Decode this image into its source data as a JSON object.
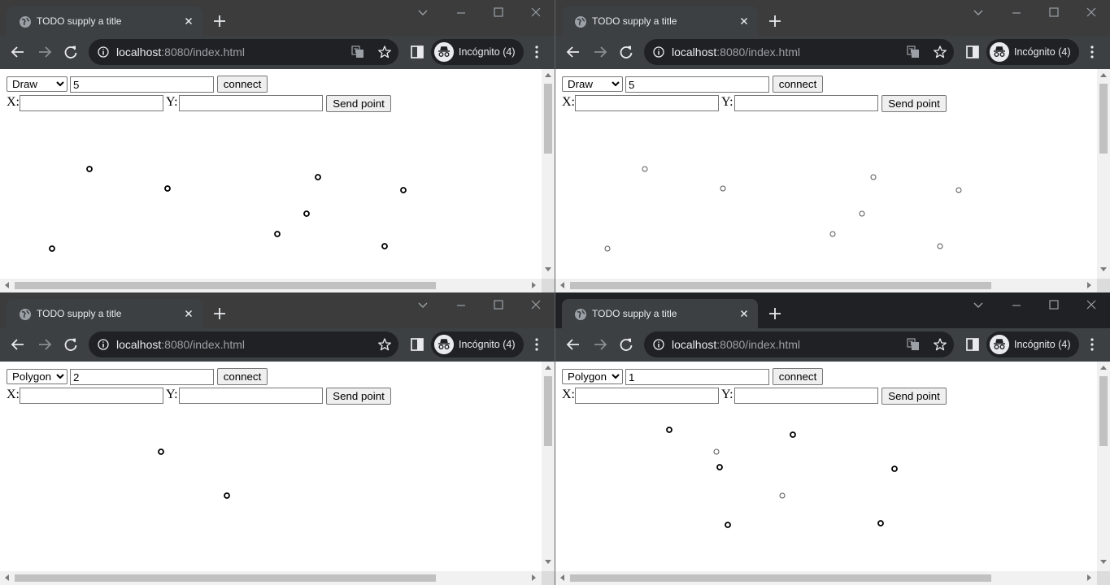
{
  "windows": [
    {
      "tab_title": "TODO supply a title",
      "url_host": "localhost",
      "url_rest": ":8080/index.html",
      "profile_label": "Incógnito (4)",
      "mode_options": [
        "Draw",
        "Polygon"
      ],
      "mode_value": "Draw",
      "id_value": "5",
      "connect_label": "connect",
      "x_label": "X:",
      "y_label": "Y:",
      "x_value": "",
      "y_value": "",
      "send_label": "Send point",
      "active": false,
      "translate_icon": true,
      "points": [
        [
          110,
          123,
          "heavy"
        ],
        [
          206,
          147,
          "heavy"
        ],
        [
          391,
          133,
          "heavy"
        ],
        [
          496,
          149,
          "heavy"
        ],
        [
          377,
          178,
          "heavy"
        ],
        [
          341,
          203,
          "heavy"
        ],
        [
          473,
          218,
          "heavy"
        ],
        [
          64,
          221,
          "heavy"
        ]
      ]
    },
    {
      "tab_title": "TODO supply a title",
      "url_host": "localhost",
      "url_rest": ":8080/index.html",
      "profile_label": "Incógnito (4)",
      "mode_options": [
        "Draw",
        "Polygon"
      ],
      "mode_value": "Draw",
      "id_value": "5",
      "connect_label": "connect",
      "x_label": "X:",
      "y_label": "Y:",
      "x_value": "",
      "y_value": "",
      "send_label": "Send point",
      "active": false,
      "translate_icon": true,
      "points": [
        [
          110,
          123,
          "light"
        ],
        [
          206,
          147,
          "light"
        ],
        [
          391,
          133,
          "light"
        ],
        [
          496,
          149,
          "light"
        ],
        [
          377,
          178,
          "light"
        ],
        [
          341,
          203,
          "light"
        ],
        [
          473,
          218,
          "light"
        ],
        [
          64,
          221,
          "light"
        ]
      ]
    },
    {
      "tab_title": "TODO supply a title",
      "url_host": "localhost",
      "url_rest": ":8080/index.html",
      "profile_label": "Incógnito (4)",
      "mode_options": [
        "Draw",
        "Polygon"
      ],
      "mode_value": "Polygon",
      "id_value": "2",
      "connect_label": "connect",
      "x_label": "X:",
      "y_label": "Y:",
      "x_value": "",
      "y_value": "",
      "send_label": "Send point",
      "active": false,
      "translate_icon": false,
      "points": [
        [
          198,
          111,
          "heavy"
        ],
        [
          279,
          165,
          "heavy"
        ]
      ]
    },
    {
      "tab_title": "TODO supply a title",
      "url_host": "localhost",
      "url_rest": ":8080/index.html",
      "profile_label": "Incógnito (4)",
      "mode_options": [
        "Draw",
        "Polygon"
      ],
      "mode_value": "Polygon",
      "id_value": "1",
      "connect_label": "connect",
      "x_label": "X:",
      "y_label": "Y:",
      "x_value": "",
      "y_value": "",
      "send_label": "Send point",
      "active": true,
      "translate_icon": true,
      "points": [
        [
          140,
          84,
          "heavy"
        ],
        [
          292,
          90,
          "heavy"
        ],
        [
          198,
          111,
          "light"
        ],
        [
          202,
          130,
          "heavy"
        ],
        [
          417,
          132,
          "heavy"
        ],
        [
          279,
          165,
          "light"
        ],
        [
          212,
          201,
          "heavy"
        ],
        [
          400,
          199,
          "heavy"
        ]
      ]
    }
  ],
  "colors": {
    "titlebar_inactive": "#3c3c3c",
    "titlebar_active": "#202124",
    "toolbar": "#3c4043",
    "omnibox": "#202124",
    "text_light": "#e8eaed",
    "text_dim": "#9aa0a6"
  },
  "icons": [
    "globe-icon",
    "close-icon",
    "plus-icon",
    "minimize-icon",
    "maximize-icon",
    "chevron-down-icon",
    "back-arrow-icon",
    "forward-arrow-icon",
    "reload-icon",
    "info-icon",
    "translate-icon",
    "star-icon",
    "sidepanel-icon",
    "incognito-icon",
    "kebab-menu-icon"
  ]
}
